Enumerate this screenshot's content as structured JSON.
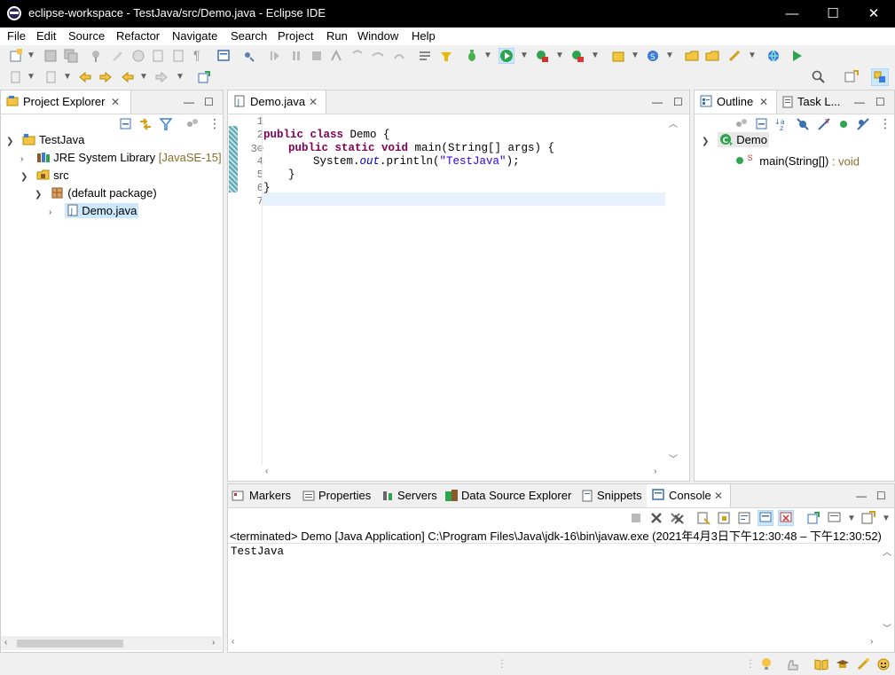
{
  "window": {
    "title": "eclipse-workspace - TestJava/src/Demo.java - Eclipse IDE",
    "controls": {
      "minimize": "—",
      "maximize": "☐",
      "close": "✕"
    }
  },
  "menu": [
    "File",
    "Edit",
    "Source",
    "Refactor",
    "Navigate",
    "Search",
    "Project",
    "Run",
    "Window",
    "Help"
  ],
  "project_explorer": {
    "tab_label": "Project Explorer",
    "tree": [
      {
        "label": "TestJava",
        "depth": 0,
        "expanded": true
      },
      {
        "label": "JRE System Library",
        "suffix": "[JavaSE-15]",
        "depth": 1,
        "expanded": false
      },
      {
        "label": "src",
        "depth": 1,
        "expanded": true
      },
      {
        "label": "(default package)",
        "depth": 2,
        "expanded": true
      },
      {
        "label": "Demo.java",
        "depth": 3,
        "expanded": false,
        "selected": true
      }
    ]
  },
  "editor": {
    "tab_label": "Demo.java",
    "line_numbers": [
      "1",
      "2",
      "3⊖",
      "4",
      "5",
      "6",
      "7"
    ],
    "code": {
      "l2_kw": "public class",
      "l2_rest": " Demo {",
      "l3_kw": "public static void",
      "l3_rest": " main(String[] args) {",
      "l4_a": "System.",
      "l4_field": "out",
      "l4_b": ".println(",
      "l4_str": "\"TestJava\"",
      "l4_c": ");",
      "l5": "}",
      "l6": "}"
    }
  },
  "outline": {
    "tab_label": "Outline",
    "tab2_label": "Task L...",
    "class_name": "Demo",
    "method_name": "main(String[])",
    "method_type": " : void",
    "static_marker": "S"
  },
  "bottom_tabs": {
    "markers": "Markers",
    "properties": "Properties",
    "servers": "Servers",
    "data_source": "Data Source Explorer",
    "snippets": "Snippets",
    "console": "Console"
  },
  "console": {
    "header": "<terminated> Demo [Java Application] C:\\Program Files\\Java\\jdk-16\\bin\\javaw.exe  (2021年4月3日下午12:30:48 – 下午12:30:52)",
    "output": "TestJava"
  },
  "colors": {
    "keyword": "#7f0055",
    "string": "#2a00ff",
    "field": "#0000c0",
    "selection": "#cce8ff",
    "current_line": "#e8f2fe"
  }
}
